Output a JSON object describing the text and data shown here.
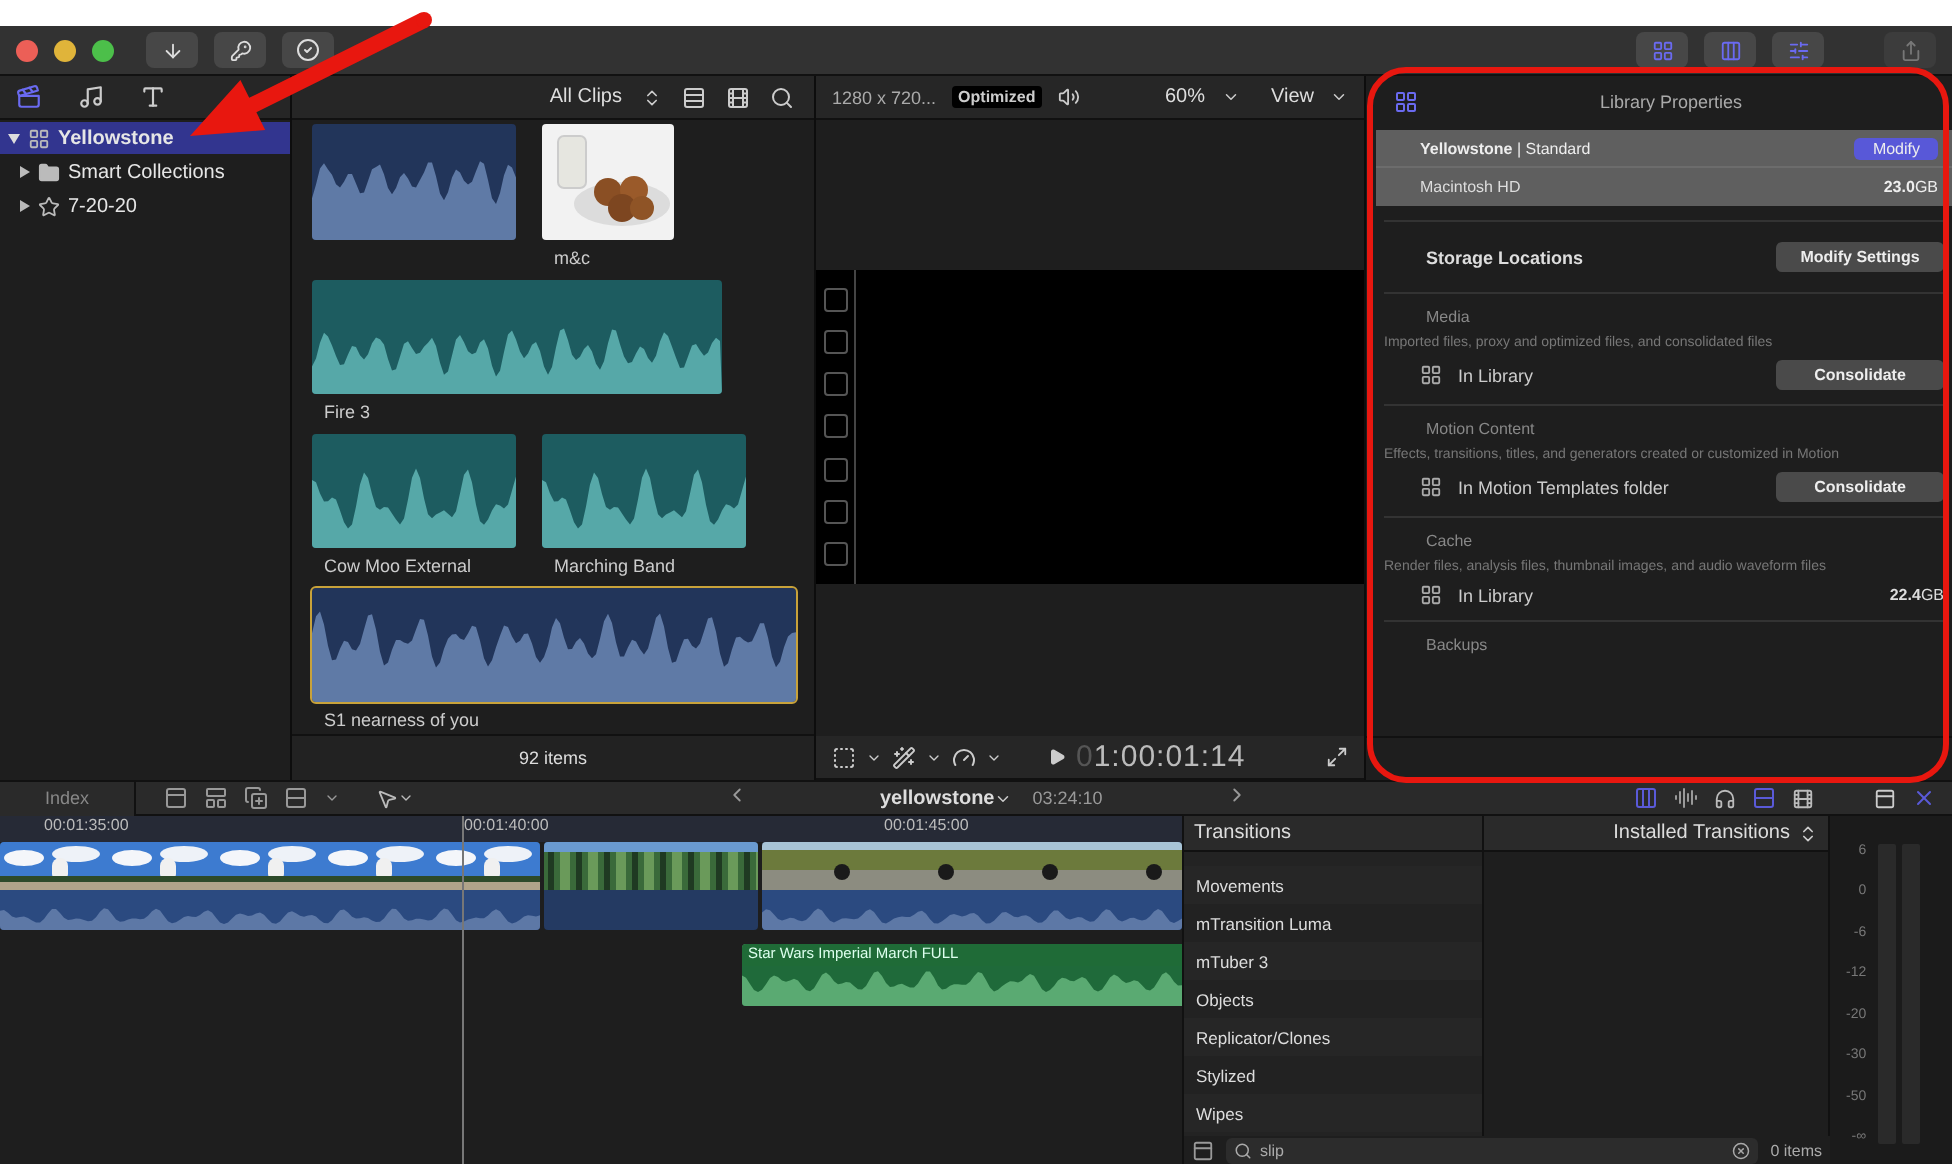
{
  "sidebar": {
    "items": [
      {
        "label": "Yellowstone",
        "kind": "library",
        "selected": true,
        "expanded": true,
        "children": [
          {
            "label": "Smart Collections",
            "kind": "folder",
            "selected": false,
            "expanded": false
          },
          {
            "label": "7-20-20",
            "kind": "event",
            "selected": false,
            "expanded": false
          }
        ]
      }
    ]
  },
  "browser": {
    "filter": "All Clips",
    "rows": [
      [
        {
          "kind": "music",
          "selected": false
        },
        {
          "name": "m&c",
          "selected": false
        }
      ],
      [
        {
          "kind": "waveform",
          "name": "Fire 3",
          "selected": false
        }
      ],
      [
        {
          "kind": "waveform",
          "name": "Cow Moo External",
          "selected": false
        },
        {
          "kind": "waveform",
          "name": "Marching Band",
          "selected": false
        }
      ],
      [
        {
          "kind": "music",
          "name": "S1 nearness of you",
          "selected": true
        }
      ]
    ],
    "footer": "92 items"
  },
  "viewer": {
    "format": "1280 x 720...",
    "badge": "Optimized",
    "zoom": "60%",
    "view": "View",
    "timecode_lead": "0",
    "timecode": "1:00:01:14"
  },
  "inspector": {
    "title": "Library Properties",
    "library": "**Yellowstone** | Standard",
    "modify": "Modify",
    "disk": "Macintosh HD",
    "disk_size": "**23.0**GB",
    "storage": "Storage Locations",
    "storage_button": "Modify Settings",
    "sections": [
      {
        "title": "Media",
        "description": "Imported files, proxy and optimized files, and consolidated files",
        "location": "In Library",
        "kind": "button",
        "action": "Consolidate"
      },
      {
        "title": "Motion Content",
        "description": "Effects, transitions, titles, and generators created or customized in Motion",
        "location": "In Motion Templates folder",
        "kind": "button",
        "action": "Consolidate"
      },
      {
        "title": "Cache",
        "description": "Render files, analysis files, thumbnail images, and audio waveform files",
        "location": "In Library",
        "kind": "size",
        "size": "**22.4**GB"
      },
      {
        "title": "Backups",
        "kind": "heading"
      }
    ]
  },
  "timeline": {
    "index": "Index",
    "project": "yellowstone",
    "duration": "03:24:10",
    "ruler": [
      "00:01:35:00",
      "00:01:40:00",
      "00:01:45:00"
    ],
    "clips": [
      {
        "kind": "geyser"
      },
      {
        "kind": "forest"
      },
      {
        "kind": "road"
      }
    ],
    "connected": "Star Wars Imperial March FULL"
  },
  "transitions": {
    "title": "Transitions",
    "category": "Installed Transitions",
    "items": [
      {
        "label": "Movements",
        "selected": false
      },
      {
        "label": "mTransition Luma",
        "selected": false
      },
      {
        "label": "mTuber 3",
        "selected": false
      },
      {
        "label": "Objects",
        "selected": false
      },
      {
        "label": "Replicator/Clones",
        "selected": false
      },
      {
        "label": "Stylized",
        "selected": false
      },
      {
        "label": "Wipes",
        "selected": false
      }
    ],
    "search": "slip",
    "count": "0 items"
  },
  "meter": {
    "ticks": [
      "6",
      "0",
      "-6",
      "-12",
      "-20",
      "-30",
      "-50",
      "-∞"
    ]
  }
}
